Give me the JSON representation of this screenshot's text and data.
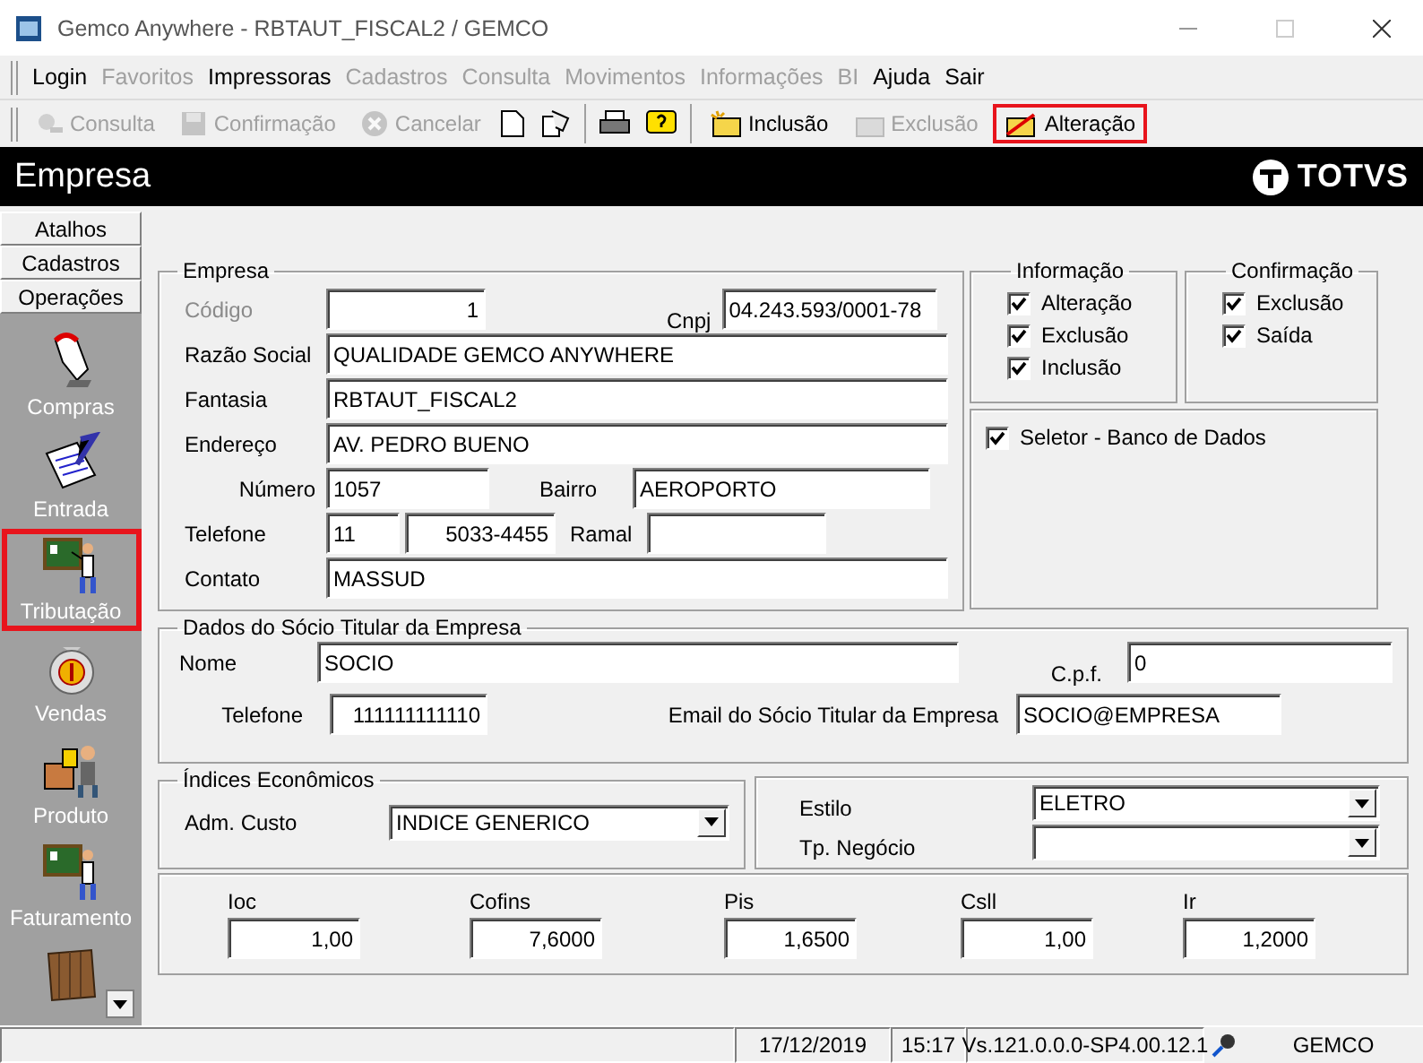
{
  "window": {
    "title": "Gemco Anywhere - RBTAUT_FISCAL2 / GEMCO"
  },
  "menu": [
    {
      "label": "Login",
      "disabled": false
    },
    {
      "label": "Favoritos",
      "disabled": true
    },
    {
      "label": "Impressoras",
      "disabled": false
    },
    {
      "label": "Cadastros",
      "disabled": true
    },
    {
      "label": "Consulta",
      "disabled": true
    },
    {
      "label": "Movimentos",
      "disabled": true
    },
    {
      "label": "Informações",
      "disabled": true
    },
    {
      "label": "BI",
      "disabled": true
    },
    {
      "label": "Ajuda",
      "disabled": false
    },
    {
      "label": "Sair",
      "disabled": false
    }
  ],
  "toolbar": {
    "groups": [
      [
        {
          "kind": "labeled",
          "label": "Consulta",
          "disabled": true,
          "highlighted": false
        },
        {
          "kind": "labeled",
          "label": "Confirmação",
          "disabled": true,
          "highlighted": false
        },
        {
          "kind": "labeled",
          "label": "Cancelar",
          "disabled": true,
          "highlighted": false
        },
        {
          "kind": "icon",
          "disabled": false,
          "highlighted": false
        },
        {
          "kind": "icon",
          "disabled": false,
          "highlighted": false
        }
      ],
      [
        {
          "kind": "icon",
          "disabled": false,
          "highlighted": false
        },
        {
          "kind": "icon",
          "disabled": false,
          "highlighted": false
        }
      ],
      [
        {
          "kind": "labeled",
          "label": "Inclusão",
          "disabled": false,
          "highlighted": false
        },
        {
          "kind": "labeled",
          "label": "Exclusão",
          "disabled": true,
          "highlighted": false
        },
        {
          "kind": "labeled",
          "label": "Alteração",
          "disabled": false,
          "highlighted": true
        }
      ]
    ]
  },
  "header": {
    "title": "Empresa",
    "brand": "TOTVS"
  },
  "sidebar": {
    "tabs": [
      {
        "label": "Atalhos"
      },
      {
        "label": "Cadastros"
      },
      {
        "label": "Operações"
      }
    ],
    "items": [
      {
        "label": "Compras",
        "highlighted": false
      },
      {
        "label": "Entrada",
        "highlighted": false
      },
      {
        "label": "Tributação",
        "highlighted": true
      },
      {
        "label": "Vendas",
        "highlighted": false
      },
      {
        "label": "Produto",
        "highlighted": false
      },
      {
        "label": "Faturamento",
        "highlighted": false
      },
      {
        "highlighted": false
      }
    ]
  },
  "empresa": {
    "title": "Empresa",
    "codigo": {
      "label": "Código",
      "value": "1",
      "disabled": true
    },
    "cnpj": {
      "label": "Cnpj",
      "value": "04.243.593/0001-78"
    },
    "razao_social": {
      "label": "Razão Social",
      "value": "QUALIDADE GEMCO ANYWHERE"
    },
    "fantasia": {
      "label": "Fantasia",
      "value": "RBTAUT_FISCAL2"
    },
    "endereco": {
      "label": "Endereço",
      "value": "AV. PEDRO BUENO"
    },
    "numero": {
      "label": "Número",
      "value": "1057"
    },
    "bairro": {
      "label": "Bairro",
      "value": "AEROPORTO"
    },
    "telefone": {
      "label": "Telefone",
      "ddd": "11",
      "number": "5033-4455"
    },
    "ramal": {
      "label": "Ramal"
    },
    "contato": {
      "label": "Contato",
      "value": "MASSUD"
    }
  },
  "informacao": {
    "title": "Informação",
    "options": [
      {
        "label": "Alteração",
        "checked": true
      },
      {
        "label": "Exclusão",
        "checked": true
      },
      {
        "label": "Inclusão",
        "checked": true
      }
    ]
  },
  "confirmacao": {
    "title": "Confirmação",
    "options": [
      {
        "label": "Exclusão",
        "checked": true
      },
      {
        "label": "Saída",
        "checked": true
      }
    ]
  },
  "seletor": {
    "label": "Seletor - Banco de Dados",
    "checked": true
  },
  "socio": {
    "title": "Dados do Sócio Titular da Empresa",
    "nome": {
      "label": "Nome",
      "value": "SOCIO"
    },
    "cpf": {
      "label": "C.p.f.",
      "value": "0"
    },
    "telefone": {
      "label": "Telefone",
      "value": "111111111110"
    },
    "email": {
      "label": "Email do Sócio Titular da Empresa",
      "value": "SOCIO@EMPRESA"
    }
  },
  "indices": {
    "title": "Índices Econômicos",
    "adm_custo": {
      "label": "Adm. Custo",
      "value": "INDICE GENERICO"
    }
  },
  "estilo": {
    "label": "Estilo",
    "value": "ELETRO"
  },
  "tp_negocio": {
    "label": "Tp. Negócio"
  },
  "taxes": [
    {
      "label": "Ioc",
      "value": "1,00"
    },
    {
      "label": "Cofins",
      "value": "7,6000"
    },
    {
      "label": "Pis",
      "value": "1,6500"
    },
    {
      "label": "Csll",
      "value": "1,00"
    },
    {
      "label": "Ir",
      "value": "1,2000"
    }
  ],
  "status_bar": {
    "date": "17/12/2019",
    "time": "15:17",
    "version": "Vs.121.0.0.0-SP4.00.12.1",
    "user": "GEMCO"
  }
}
